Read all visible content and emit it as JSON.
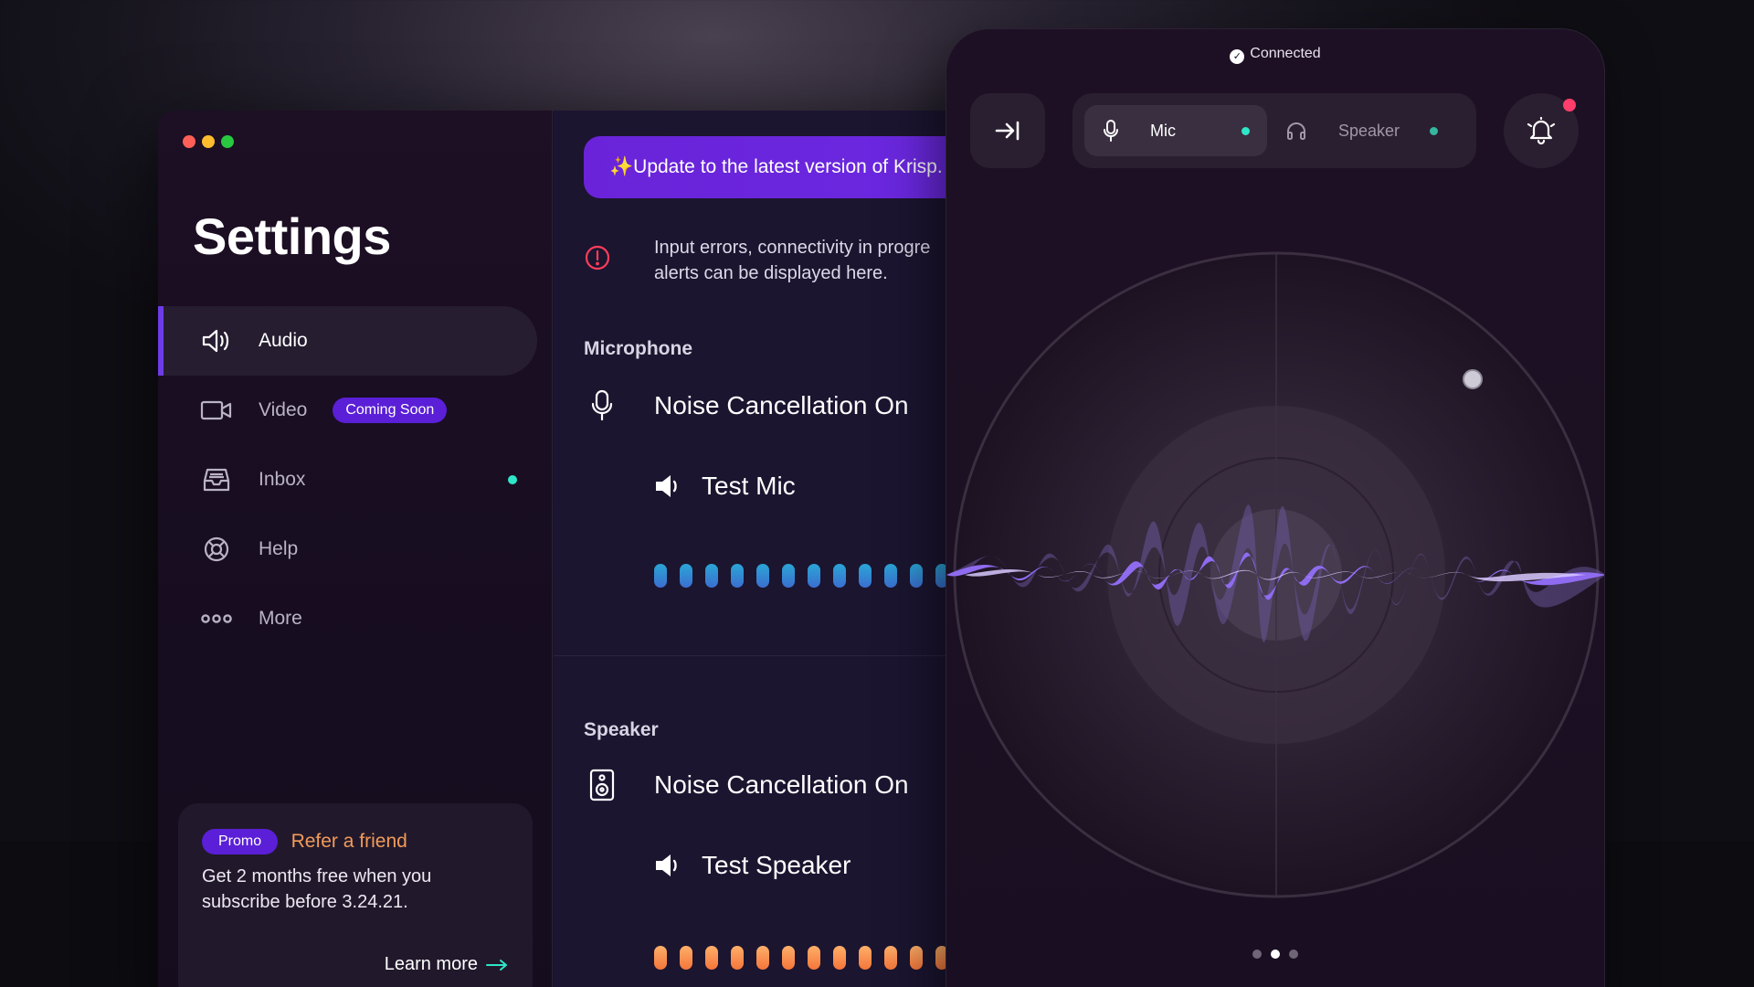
{
  "window": {
    "title": "Settings"
  },
  "sidebar": {
    "items": [
      {
        "label": "Audio",
        "icon": "speaker-icon",
        "active": true
      },
      {
        "label": "Video",
        "icon": "video-camera-icon",
        "badge": "Coming Soon"
      },
      {
        "label": "Inbox",
        "icon": "inbox-icon",
        "has_dot": true
      },
      {
        "label": "Help",
        "icon": "lifebuoy-icon"
      },
      {
        "label": "More",
        "icon": "more-dots-icon"
      }
    ],
    "promo": {
      "tag": "Promo",
      "title": "Refer a friend",
      "text": "Get 2 months free when you subscribe before 3.24.21.",
      "link": "Learn more"
    }
  },
  "main": {
    "update_banner": "✨Update to the latest version of Krisp.",
    "alert": {
      "line1": "Input errors, connectivity in progre",
      "line2": "alerts can be displayed here."
    },
    "microphone": {
      "heading": "Microphone",
      "status": "Noise Cancellation On",
      "test_label": "Test Mic",
      "level_bars": 12
    },
    "speaker": {
      "heading": "Speaker",
      "status": "Noise Cancellation On",
      "test_label": "Test Speaker",
      "level_bars": 12
    }
  },
  "widget": {
    "status": "Connected",
    "tabs": [
      {
        "label": "Mic",
        "icon": "microphone-icon",
        "active": true
      },
      {
        "label": "Speaker",
        "icon": "headphones-icon",
        "active": false
      }
    ],
    "pager": {
      "count": 3,
      "active": 1
    }
  },
  "colors": {
    "accent": "#6d3ce6",
    "teal": "#2ee6c8",
    "alert": "#ff3e6c",
    "promo_orange": "#f39a5a"
  }
}
